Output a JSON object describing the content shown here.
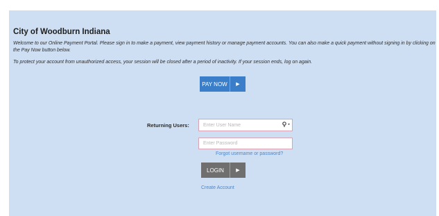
{
  "portal": {
    "title": "City of Woodburn Indiana",
    "intro": "Welcome to our Online Payment Portal.  Please sign in to make a payment, view payment history or manage payment accounts.  You can also make a quick payment without signing in by clicking on the Pay Now button below.",
    "notice": "To protect your account from unauthorized access, your session will be closed after a period of inactivity.  If your session ends, log on again."
  },
  "pay_now": {
    "label": "PAY NOW",
    "arrow": "▶"
  },
  "login_form": {
    "returning_label": "Returning Users:",
    "username_placeholder": "Enter User Name",
    "username_icon": "key-icon",
    "password_placeholder": "Enter Password",
    "forgot_link": "Forgot username or password?",
    "login_label": "LOGIN",
    "login_arrow": "▶",
    "create_account": "Create Account"
  },
  "colors": {
    "panel_bg": "#cfdff3",
    "pay_now_bg": "#3a7ec9",
    "login_bg": "#6f6f6f",
    "link": "#4b86c9",
    "field_border": "#d9a3b4"
  }
}
